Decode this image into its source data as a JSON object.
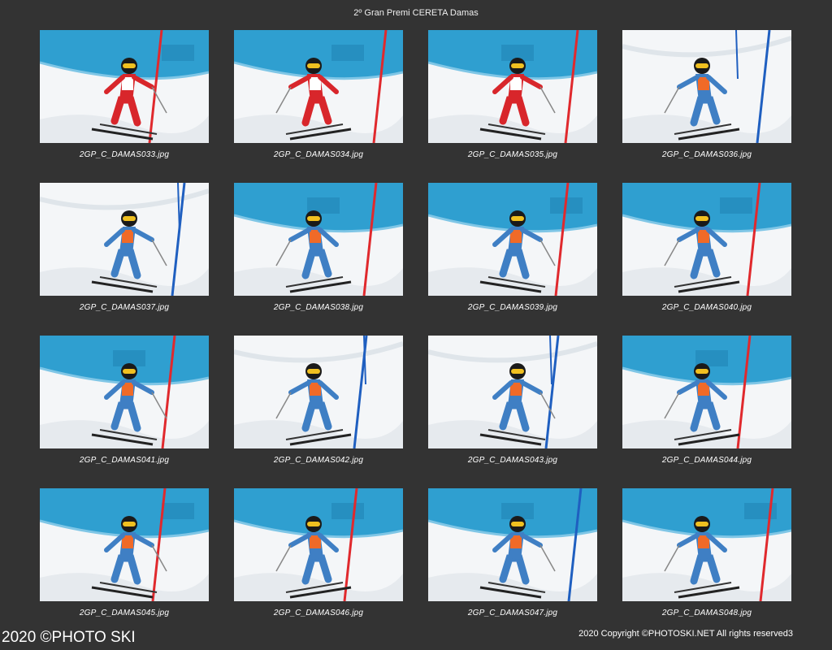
{
  "header": {
    "title": "2º Gran Premi CERETA Damas"
  },
  "photos": [
    {
      "filename": "2GP_C_DAMAS033.jpg",
      "suit": "red",
      "fence": true,
      "gate": "red"
    },
    {
      "filename": "2GP_C_DAMAS034.jpg",
      "suit": "red",
      "fence": true,
      "gate": "red"
    },
    {
      "filename": "2GP_C_DAMAS035.jpg",
      "suit": "red",
      "fence": true,
      "gate": "red"
    },
    {
      "filename": "2GP_C_DAMAS036.jpg",
      "suit": "blue",
      "fence": false,
      "gate": "blue"
    },
    {
      "filename": "2GP_C_DAMAS037.jpg",
      "suit": "blue",
      "fence": false,
      "gate": "blue"
    },
    {
      "filename": "2GP_C_DAMAS038.jpg",
      "suit": "blue",
      "fence": true,
      "gate": "red"
    },
    {
      "filename": "2GP_C_DAMAS039.jpg",
      "suit": "blue",
      "fence": true,
      "gate": "red"
    },
    {
      "filename": "2GP_C_DAMAS040.jpg",
      "suit": "blue",
      "fence": true,
      "gate": "red"
    },
    {
      "filename": "2GP_C_DAMAS041.jpg",
      "suit": "blue",
      "fence": true,
      "gate": "red"
    },
    {
      "filename": "2GP_C_DAMAS042.jpg",
      "suit": "blue",
      "fence": false,
      "gate": "blue"
    },
    {
      "filename": "2GP_C_DAMAS043.jpg",
      "suit": "blue",
      "fence": false,
      "gate": "blue"
    },
    {
      "filename": "2GP_C_DAMAS044.jpg",
      "suit": "blue",
      "fence": true,
      "gate": "red"
    },
    {
      "filename": "2GP_C_DAMAS045.jpg",
      "suit": "blue",
      "fence": true,
      "gate": "red"
    },
    {
      "filename": "2GP_C_DAMAS046.jpg",
      "suit": "blue",
      "fence": true,
      "gate": "red"
    },
    {
      "filename": "2GP_C_DAMAS047.jpg",
      "suit": "blue",
      "fence": true,
      "gate": "blue"
    },
    {
      "filename": "2GP_C_DAMAS048.jpg",
      "suit": "blue",
      "fence": true,
      "gate": "red"
    }
  ],
  "footer": {
    "watermark": "2020 ©PHOTO SKI",
    "copyright": "2020 Copyright ©PHOTOSKI.NET All rights reserved",
    "page_number": "3"
  },
  "colors": {
    "background": "#333333",
    "snow": "#f4f6f8",
    "fence": "#2f9fd0",
    "red_suit": "#d8262b",
    "blue_suit": "#3f7fc4",
    "bib_orange": "#f06a28",
    "gate_red": "#e0292d",
    "gate_blue": "#1f5fc0"
  }
}
